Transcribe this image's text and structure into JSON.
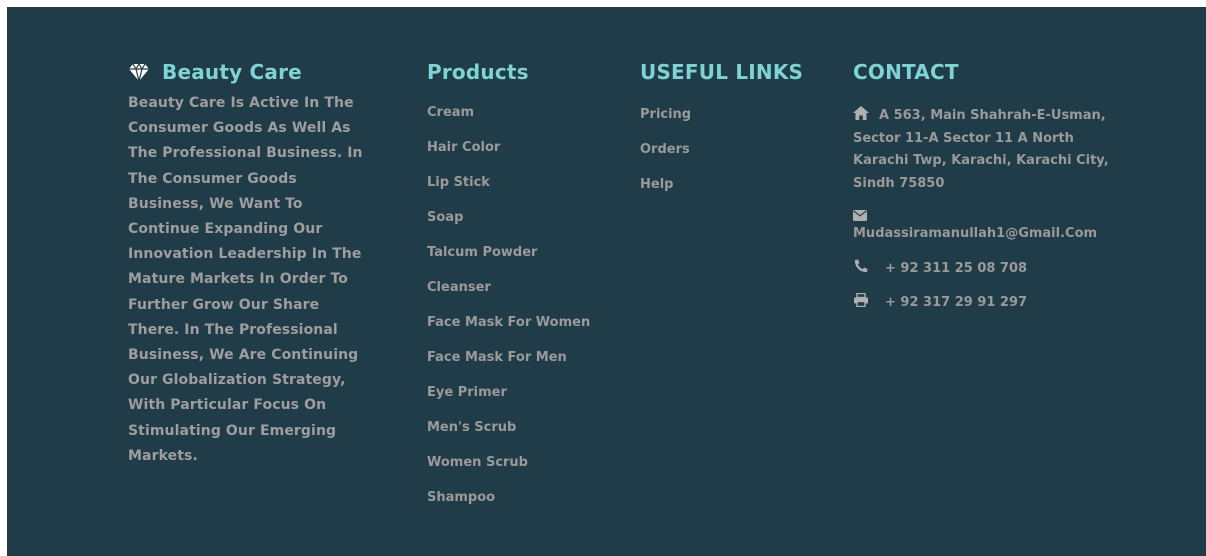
{
  "brand": {
    "name": "Beauty Care",
    "description": "Beauty Care Is Active In The Consumer Goods As Well As The Professional Business. In The Consumer Goods Business, We Want To Continue Expanding Our Innovation Leadership In The Mature Markets In Order To Further Grow Our Share There. In The Professional Business, We Are Continuing Our Globalization Strategy, With Particular Focus On Stimulating Our Emerging Markets.",
    "icon": "diamond-icon"
  },
  "products": {
    "heading": "Products",
    "items": [
      "Cream",
      "Hair Color",
      "Lip Stick",
      "Soap",
      "Talcum Powder",
      "Cleanser",
      "Face Mask For Women",
      "Face Mask For Men",
      "Eye Primer",
      "Men's Scrub",
      "Women Scrub",
      "Shampoo"
    ]
  },
  "useful_links": {
    "heading": "USEFUL LINKS",
    "items": [
      "Pricing",
      "Orders",
      "Help"
    ]
  },
  "contact": {
    "heading": "CONTACT",
    "address": "A 563, Main Shahrah-E-Usman, Sector 11-A Sector 11 A North Karachi Twp, Karachi, Karachi City, Sindh 75850",
    "email": "Mudassiramanullah1@Gmail.Com",
    "phone": "+ 92 311 25 08 708",
    "fax": "+ 92 317 29 91 297",
    "icons": {
      "address": "home-icon",
      "email": "envelope-icon",
      "phone": "phone-icon",
      "fax": "printer-icon"
    }
  },
  "colors": {
    "background": "#203c48",
    "heading": "#7fd3d4",
    "text": "#9a9a9a"
  }
}
